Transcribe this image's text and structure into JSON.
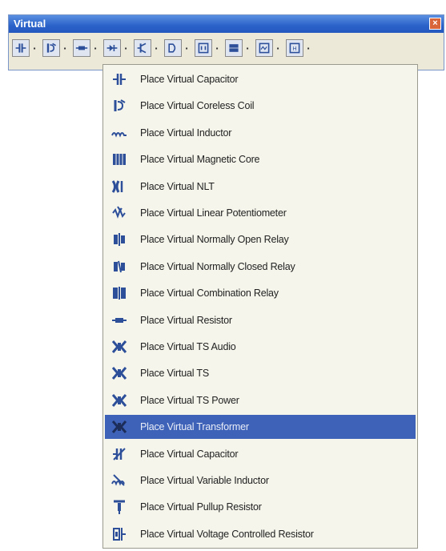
{
  "window": {
    "title": "Virtual",
    "close_glyph": "×"
  },
  "toolbar": {
    "buttons": [
      {
        "icon": "capacitor-icon"
      },
      {
        "icon": "coreless-coil-icon"
      },
      {
        "icon": "resistor-icon"
      },
      {
        "icon": "diode-icon"
      },
      {
        "icon": "transistor-icon"
      },
      {
        "icon": "gate-icon"
      },
      {
        "icon": "meter-icon"
      },
      {
        "icon": "block-icon"
      },
      {
        "icon": "signal-icon"
      },
      {
        "icon": "source-icon"
      }
    ],
    "dropdown_glyph": "▪"
  },
  "menu": {
    "selected_index": 13,
    "items": [
      {
        "label": "Place Virtual Capacitor",
        "icon": "capacitor-icon"
      },
      {
        "label": "Place Virtual Coreless Coil",
        "icon": "coreless-coil-icon"
      },
      {
        "label": "Place Virtual Inductor",
        "icon": "inductor-icon"
      },
      {
        "label": "Place Virtual Magnetic Core",
        "icon": "magnetic-core-icon"
      },
      {
        "label": "Place Virtual NLT",
        "icon": "nlt-icon"
      },
      {
        "label": "Place Virtual Linear Potentiometer",
        "icon": "potentiometer-icon"
      },
      {
        "label": "Place Virtual Normally Open Relay",
        "icon": "relay-open-icon"
      },
      {
        "label": "Place Virtual Normally Closed Relay",
        "icon": "relay-closed-icon"
      },
      {
        "label": "Place Virtual Combination Relay",
        "icon": "relay-combination-icon"
      },
      {
        "label": "Place Virtual Resistor",
        "icon": "resistor-icon"
      },
      {
        "label": "Place Virtual TS Audio",
        "icon": "ts-audio-icon"
      },
      {
        "label": "Place Virtual TS",
        "icon": "ts-icon"
      },
      {
        "label": "Place Virtual TS Power",
        "icon": "ts-power-icon"
      },
      {
        "label": "Place Virtual Transformer",
        "icon": "transformer-icon"
      },
      {
        "label": "Place Virtual Capacitor",
        "icon": "variable-capacitor-icon"
      },
      {
        "label": "Place Virtual Variable Inductor",
        "icon": "variable-inductor-icon"
      },
      {
        "label": "Place Virtual Pullup Resistor",
        "icon": "pullup-resistor-icon"
      },
      {
        "label": "Place Virtual Voltage Controlled Resistor",
        "icon": "voltage-controlled-resistor-icon"
      }
    ]
  },
  "colors": {
    "title_bar": "#2a62c9",
    "selection": "#3d62b8",
    "menu_background": "#f5f5ec",
    "toolbar_background": "#ece9d8",
    "icon_blue": "#2d4f9a"
  }
}
